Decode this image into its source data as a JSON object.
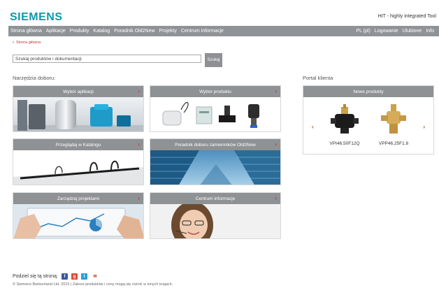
{
  "header": {
    "logo": "SIEMENS",
    "tagline": "HIT - highly integrated Tool"
  },
  "nav": {
    "left": [
      "Strona główna",
      "Aplikacje",
      "Produkty",
      "Katalog",
      "Poradnik Old2New",
      "Projekty",
      "Centrum informacje"
    ],
    "right": [
      "PL (pl)",
      "Logowanie",
      "Ulubione",
      "Info"
    ]
  },
  "breadcrumb": {
    "label": "Strona główna"
  },
  "search": {
    "value": "Szukaj produktów i dokumentacji",
    "button": "Szukaj"
  },
  "tools": {
    "title": "Narzędzia doboru:",
    "tiles": [
      {
        "label": "Wybór aplikacji"
      },
      {
        "label": "Wybór produktu"
      },
      {
        "label": "Przeglądaj w Katalogu"
      },
      {
        "label": "Poradnik doboru zamienników Old2New"
      },
      {
        "label": "Zarządzaj projektami"
      },
      {
        "label": "Centrum informacje"
      }
    ]
  },
  "portal": {
    "title": "Portal klienta",
    "header": "Nowe produkty",
    "products": [
      {
        "name": "VPI46.50F12Q"
      },
      {
        "name": "VPP46.25F1.8"
      }
    ]
  },
  "share": {
    "label": "Podziel się tą stroną:"
  },
  "footer": {
    "text": "© Siemens Bwitzerland Ltd. 2015 | Zakres produktów i ceny mogą się różnić w innych krajach."
  },
  "colors": {
    "brand": "#0a9aa8",
    "nav_bg": "#8f9396",
    "accent_red": "#c0392b"
  }
}
